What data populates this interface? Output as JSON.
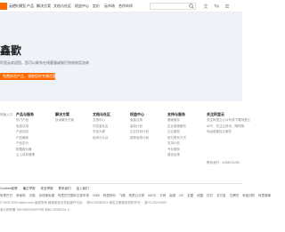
{
  "nav": {
    "items": [
      "云栖",
      "大模型",
      "产品",
      "解决方案",
      "文档与社区",
      "权益中心",
      "定价",
      "云市场",
      "合作伙伴"
    ],
    "search_placeholder": ""
  },
  "hero": {
    "title": "鑫歡",
    "desc": "阿里云欢迎您，您可以联系在线客服或拨打热线电话咨询",
    "cta": "免费体验产品，领取您的专属优惠 →"
  },
  "footer": {
    "columns": [
      {
        "title": "",
        "items": [
          "快速入口",
          "",
          "",
          "",
          "",
          "",
          ""
        ]
      },
      {
        "title": "产品与服务",
        "items": [
          "热门产品",
          "免费试用",
          "产品动态",
          "产品最新",
          "产品定价",
          "配置报价器",
          "云上成本管理"
        ]
      },
      {
        "title": "解决方案",
        "items": [
          "技术解决方案",
          "",
          "",
          "",
          "",
          "",
          ""
        ]
      },
      {
        "title": "文档与社区",
        "items": [
          "文档中心",
          "开发者社区",
          "天池大赛",
          "培训与认证",
          "",
          "",
          ""
        ]
      },
      {
        "title": "权益中心",
        "items": [
          "免费试用",
          "高校计划",
          "企业扶持计划",
          "推荐返现计划",
          "",
          "",
          ""
        ]
      },
      {
        "title": "支持与服务",
        "items": [
          "基础服务",
          "企业增值服务",
          "迁云服务",
          "官方联系方式",
          "支持计划",
          "专业服务",
          "建议反馈"
        ]
      },
      {
        "title": "关注阿里云",
        "items": [
          "关注阿里云公众号或下载阿里云",
          "APP，关注云资讯，随时随",
          "地运维管控云服务",
          "",
          "",
          "",
          ""
        ]
      }
    ],
    "phone": "联系我们：4008013260",
    "links": [
      "Cookies政策",
      "廉正举报",
      "安全举报",
      "联系我们",
      "加入我们"
    ],
    "sites": [
      "阿里巴巴",
      "淘宝网",
      "天猫",
      "全球速卖通",
      "阿里巴巴国际交易市场",
      "1688",
      "阿里妈妈",
      "飞猪",
      "阿里云计算",
      "AliOS",
      "万网",
      "高德",
      "UC",
      "友盟",
      "优酷",
      "钉钉",
      "支付宝",
      "达摩院",
      "淘宝闪购",
      "阿里健康"
    ],
    "copyright": "© 2009-2025 aliyun.com 版权所有 增值电信业务经营许可证： 浙B2-20080101 域名注册服务机构许可： 浙D3-20210002",
    "license": "浙公网安备 33010602009975号 浙B2-20080101-4"
  },
  "colors": {
    "accent": "#ff6a00",
    "hero_bg": "#eef3fa"
  }
}
